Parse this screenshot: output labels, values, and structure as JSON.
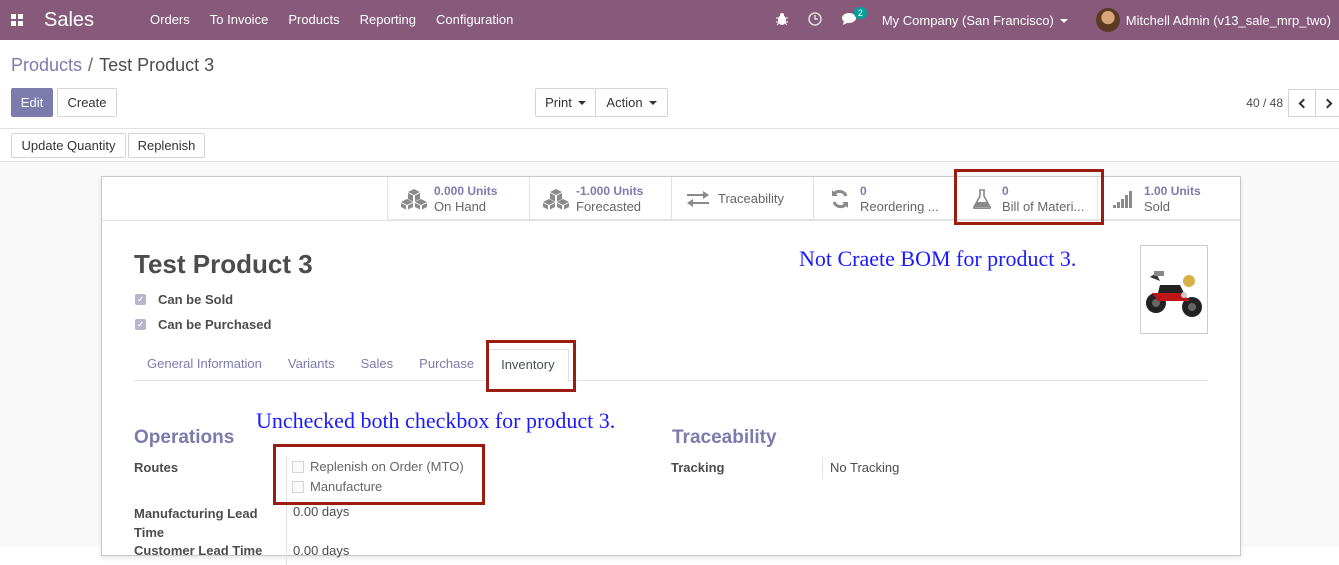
{
  "navbar": {
    "brand": "Sales",
    "menu": [
      "Orders",
      "To Invoice",
      "Products",
      "Reporting",
      "Configuration"
    ],
    "chat_count": "2",
    "company": "My Company (San Francisco)",
    "user": "Mitchell Admin (v13_sale_mrp_two)"
  },
  "breadcrumb": {
    "parent": "Products",
    "separator": "/",
    "current": "Test Product 3"
  },
  "buttons": {
    "edit": "Edit",
    "create": "Create",
    "print": "Print",
    "action": "Action",
    "update_qty": "Update Quantity",
    "replenish": "Replenish"
  },
  "pager": {
    "value": "40 / 48"
  },
  "smart_buttons": [
    {
      "value": "0.000 Units",
      "label": "On Hand",
      "icon": "cubes-icon"
    },
    {
      "value": "-1.000 Units",
      "label": "Forecasted",
      "icon": "cubes-icon"
    },
    {
      "value": "",
      "label": "Traceability",
      "icon": "arrows-exchange-icon"
    },
    {
      "value": "0",
      "label": "Reordering ...",
      "icon": "refresh-icon"
    },
    {
      "value": "0",
      "label": "Bill of Materi...",
      "icon": "flask-icon"
    },
    {
      "value": "1.00 Units",
      "label": "Sold",
      "icon": "signal-icon"
    }
  ],
  "product": {
    "name": "Test Product 3",
    "can_be_sold": "Can be Sold",
    "can_be_purchased": "Can be Purchased"
  },
  "tabs": [
    "General Information",
    "Variants",
    "Sales",
    "Purchase",
    "Inventory"
  ],
  "inventory": {
    "operations_title": "Operations",
    "routes_label": "Routes",
    "route_mto": "Replenish on Order (MTO)",
    "route_manufacture": "Manufacture",
    "mfg_lead_label": "Manufacturing Lead Time",
    "mfg_lead_value": "0.00 days",
    "cust_lead_label": "Customer Lead Time",
    "cust_lead_value": "0.00 days",
    "traceability_title": "Traceability",
    "tracking_label": "Tracking",
    "tracking_value": "No Tracking"
  },
  "annotations": {
    "bom_note": "Not Craete BOM for product 3.",
    "checkbox_note": "Unchecked both checkbox for product 3."
  },
  "colors": {
    "navbar": "#875a7b",
    "primary": "#7c7bad",
    "annotation_text": "#1a1aff",
    "annotation_box": "#9c1c12"
  }
}
